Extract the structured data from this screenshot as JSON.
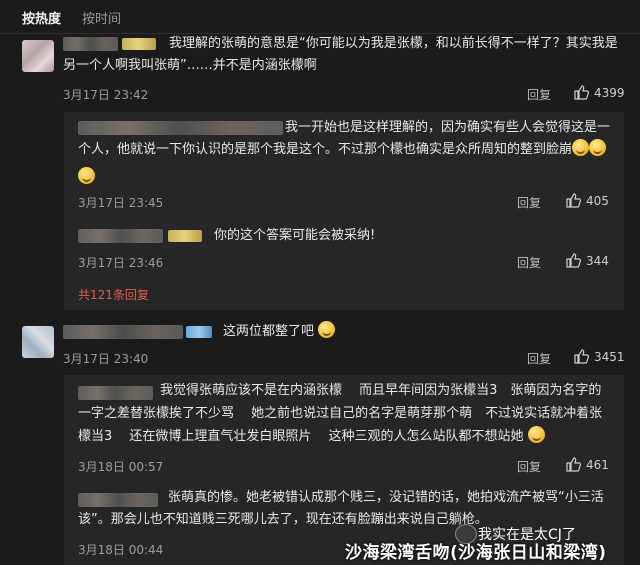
{
  "tabs": {
    "hot": "按热度",
    "time": "按时间"
  },
  "comments": [
    {
      "text1": "我理解的张萌的意思是“你可能以为我是张檬，和以前长得不一样了？其实我是",
      "text2": "另一个人啊我叫张萌”……并不是内涵张檬啊",
      "time": "3月17日 23:42",
      "reply": "回复",
      "likes": "4399"
    },
    {
      "text1": "这两位都整了吧",
      "time": "3月17日 23:40",
      "reply": "回复",
      "likes": "3451"
    }
  ],
  "subs1": [
    {
      "text1": "我一开始也是这样理解的，因为确实有些人会觉得这是一",
      "text2": "个人，他就说一下你认识的是那个我是这个。不过那个檬也确实是众所周知的整到脸崩",
      "time": "3月17日 23:45",
      "reply": "回复",
      "likes": "405"
    },
    {
      "text1": "你的这个答案可能会被采纳!",
      "time": "3月17日 23:46",
      "reply": "回复",
      "likes": "344"
    }
  ],
  "more_replies": "共121条回复",
  "subs2": [
    {
      "text1": "我觉得张萌应该不是在内涵张檬　 而且早年间因为张檬当3　张萌因为名字的",
      "text2": "一字之差替张檬挨了不少骂　 她之前也说过自己的名字是萌芽那个萌　不过说实话就冲着张",
      "text3": "檬当3　 还在微博上理直气壮发白眼照片　 这种三观的人怎么站队都不想站她",
      "time": "3月18日 00:57",
      "reply": "回复",
      "likes": "461"
    },
    {
      "text1": "张萌真的惨。她老被错认成那个贱三，没记错的话，她拍戏流产被骂“小三活",
      "text2": "该”。那会儿也不知道贱三死哪儿去了，现在还有脸蹦出来说自己躺枪。",
      "time": "3月18日 00:44"
    }
  ],
  "watermark": {
    "line1": "我实在是太CJ了",
    "line2": "沙海梁湾舌吻(沙海张日山和梁湾)"
  }
}
